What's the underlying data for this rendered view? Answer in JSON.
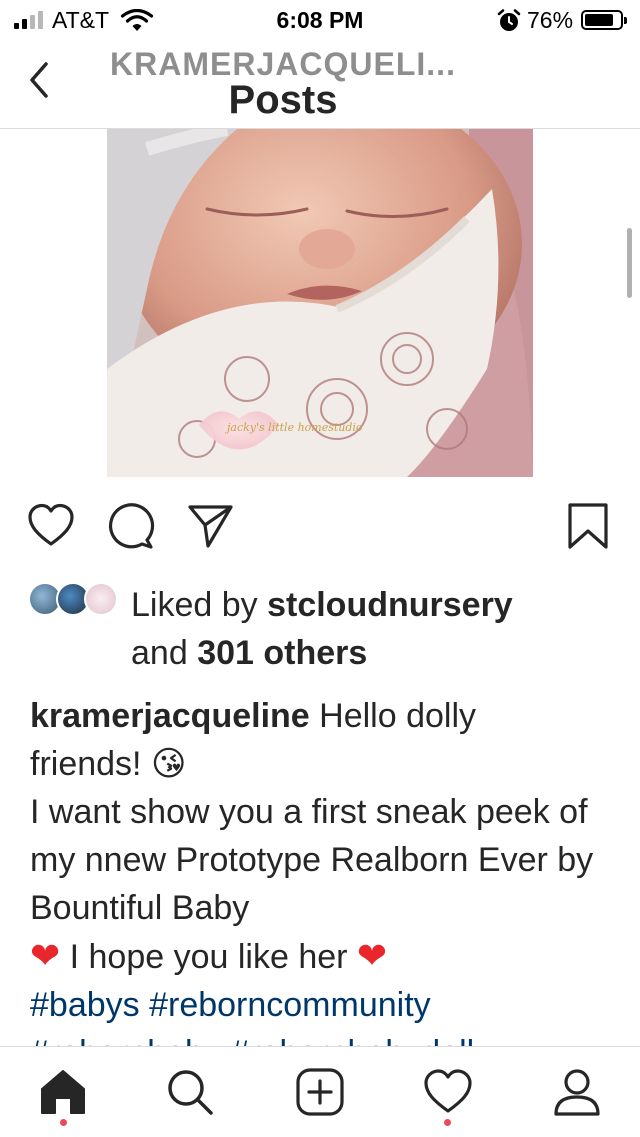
{
  "status_bar": {
    "carrier": "AT&T",
    "time": "6:08 PM",
    "battery_percent": "76%",
    "battery_level": 0.76,
    "signal_bars_active": 2,
    "signal_bars_total": 4
  },
  "header": {
    "username": "KRAMERJACQUELI...",
    "title": "Posts"
  },
  "post": {
    "image_watermark": "jacky's little homestudio",
    "likes": {
      "prefix": "Liked by ",
      "liker": "stcloudnursery",
      "middle": "and ",
      "others": "301 others"
    },
    "caption": {
      "username": "kramerjacqueline",
      "line1_text": " Hello dolly",
      "line2_text": "friends! ",
      "emoji_kiss": "😘",
      "body": "I want show you a first sneak peek of my nnew Prototype Realborn Ever by Bountiful Baby",
      "heart": "❤",
      "hope": " I hope you like her ",
      "hashtags": "#babys #reborncommunity",
      "hashtags_next": "#rebornbaby #rebornbabydoll #rebornbaby"
    }
  },
  "icons": {
    "back": "chevron-left-icon",
    "like": "heart-icon",
    "comment": "comment-icon",
    "share": "paper-plane-icon",
    "save": "bookmark-icon",
    "home": "home-icon",
    "search": "search-icon",
    "new_post": "plus-square-icon",
    "activity": "heart-icon",
    "profile": "profile-icon"
  },
  "colors": {
    "text": "#262626",
    "secondary": "#8e8e8e",
    "hashtag": "#00376b",
    "notification_dot": "#ed4956",
    "heart_emoji": "#e8262b"
  }
}
